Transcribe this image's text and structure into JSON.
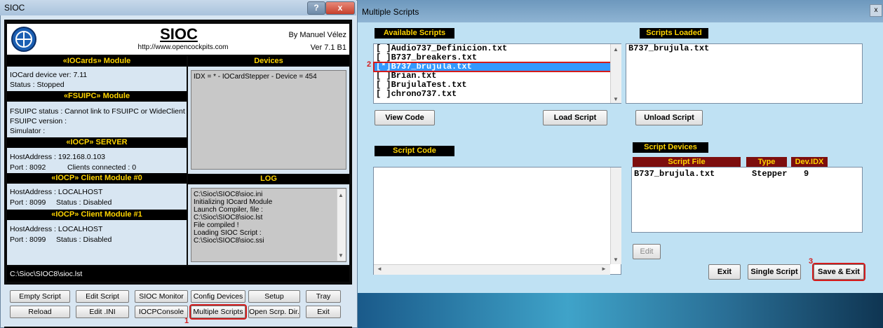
{
  "sioc": {
    "window_title": "SIOC",
    "help_label": "?",
    "close_label": "x",
    "app_name": "SIOC",
    "url": "http://www.opencockpits.com",
    "author": "By Manuel Vélez",
    "version": "Ver 7.1 B1",
    "iocards": {
      "title": "«IOCards» Module",
      "device_ver": "IOCard device ver:  7.11",
      "status": "Status : Stopped"
    },
    "devices": {
      "title": "Devices",
      "text": "IDX = * - IOCardStepper - Device = 454"
    },
    "fsuipc": {
      "title": "«FSUIPC» Module",
      "status": "FSUIPC status :  Cannot link to FSUIPC or WideClient",
      "version": "FSUIPC version :",
      "simulator": "Simulator :"
    },
    "server": {
      "title": "«IOCP» SERVER",
      "host": "HostAddress :  192.168.0.103",
      "port": "Port :  8092",
      "clients": "Clients connected :  0"
    },
    "client0": {
      "title": "«IOCP» Client Module #0",
      "host": "HostAddress :  LOCALHOST",
      "port": "Port :  8099",
      "status": "Status : Disabled"
    },
    "client1": {
      "title": "«IOCP» Client Module #1",
      "host": "HostAddress :    LOCALHOST",
      "port": "Port :  8099",
      "status": "Status : Disabled"
    },
    "log": {
      "title": "LOG",
      "lines": [
        "C:\\Sioc\\SIOC8\\sioc.ini",
        "Initializing IOcard Module",
        "Launch Compiler, file :",
        "C:\\Sioc\\SIOC8\\sioc.lst",
        "File compiled !",
        "Loading SIOC Script :",
        "C:\\Sioc\\SIOC8\\sioc.ssi"
      ]
    },
    "path": "C:\\Sioc\\SIOC8\\sioc.lst",
    "buttons": {
      "empty_script": "Empty Script",
      "edit_script": "Edit Script",
      "sioc_monitor": "SIOC Monitor",
      "config_devices": "Config Devices",
      "setup": "Setup",
      "tray": "Tray",
      "reload": "Reload",
      "edit_ini": "Edit .INI",
      "iocp_console": "IOCPConsole",
      "multiple_scripts": "Multiple Scripts",
      "open_scrp_dir": "Open Scrp. Dir.",
      "exit": "Exit"
    },
    "step1": "1"
  },
  "ms": {
    "window_title": "Multiple Scripts",
    "close_label": "x",
    "available_title": "Available Scripts",
    "available": [
      "[ ]Audio737_Definicion.txt",
      "[ ]B737_breakers.txt",
      "[*]B737_brujula.txt",
      "[ ]Brian.txt",
      "[ ]BrujulaTest.txt",
      "[ ]chrono737.txt"
    ],
    "loaded_title": "Scripts Loaded",
    "loaded": [
      "B737_brujula.txt"
    ],
    "view_code": "View Code",
    "load_script": "Load Script",
    "unload_script": "Unload Script",
    "script_code_title": "Script Code",
    "script_devices_title": "Script Devices",
    "table": {
      "headers": [
        "Script File",
        "Type",
        "Dev.IDX"
      ],
      "rows": [
        [
          "B737_brujula.txt",
          "Stepper",
          "9"
        ]
      ]
    },
    "edit": "Edit",
    "exit": "Exit",
    "single_script": "Single Script",
    "save_exit": "Save & Exit",
    "step2": "2",
    "step3": "3"
  }
}
